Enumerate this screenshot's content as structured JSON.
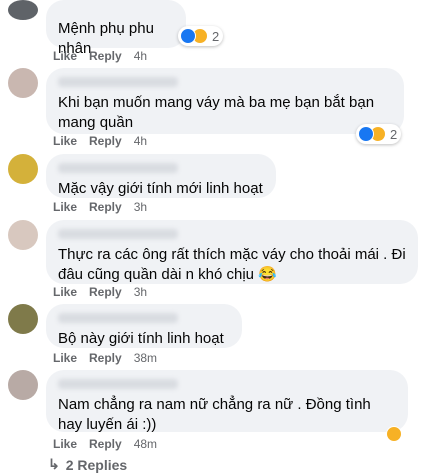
{
  "comments": [
    {
      "text": "Mệnh phụ phu nhân",
      "time": "4h",
      "reactions": {
        "icons": [
          "like-icon",
          "haha-icon"
        ],
        "count": "2"
      }
    },
    {
      "text": "Khi bạn muốn mang váy mà ba mẹ bạn bắt bạn mang quần",
      "time": "4h",
      "reactions": {
        "icons": [
          "like-icon",
          "haha-icon"
        ],
        "count": "2"
      }
    },
    {
      "text": "Mặc vậy giới tính mới linh hoạt",
      "time": "3h"
    },
    {
      "text": "Thực ra các ông rất thích mặc váy cho thoải mái . Đi đâu cũng quần dài n khó chịu 😂",
      "time": "3h"
    },
    {
      "text": "Bộ này giới tính linh hoạt",
      "time": "38m"
    },
    {
      "text": "Nam chẳng ra nam nữ chẳng ra nữ . Đồng tình hay luyến ái :))",
      "time": "48m",
      "reactions": {
        "icons": [
          "haha-icon"
        ],
        "count": ""
      }
    }
  ],
  "actions": {
    "like": "Like",
    "reply": "Reply"
  },
  "replies_link": "2 Replies",
  "colors": {
    "like": "#1877f2",
    "haha": "#f7b125",
    "bubble": "#f0f2f5",
    "meta": "#65676b"
  }
}
